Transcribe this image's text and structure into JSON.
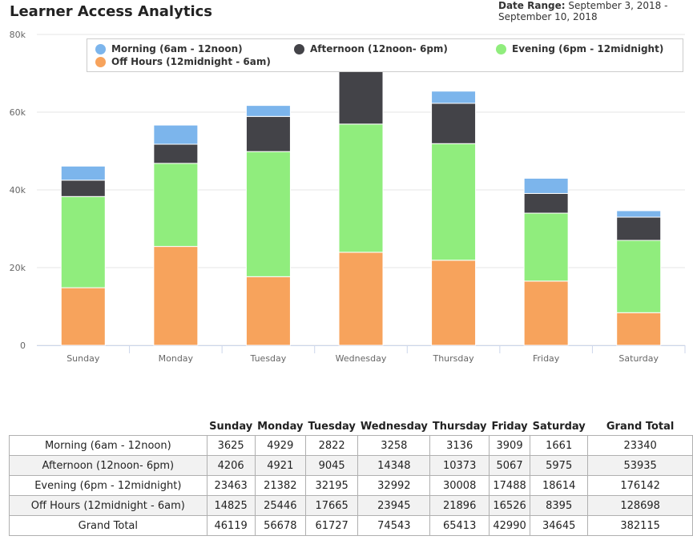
{
  "title": "Learner Access Analytics",
  "date_range": {
    "label": "Date Range:",
    "value": "September 3, 2018 - September 10, 2018"
  },
  "colors": {
    "morning": "#7cb5ec",
    "afternoon": "#434348",
    "evening": "#90ed7d",
    "off_hours": "#f7a35c",
    "grid": "#e6e6e6",
    "axis_text": "#666666"
  },
  "chart_data": {
    "type": "bar",
    "stacked": true,
    "title": "Learner Access Analytics",
    "categories": [
      "Sunday",
      "Monday",
      "Tuesday",
      "Wednesday",
      "Thursday",
      "Friday",
      "Saturday"
    ],
    "series": [
      {
        "name": "Morning (6am - 12noon)",
        "key": "morning",
        "values": [
          3625,
          4929,
          2822,
          3258,
          3136,
          3909,
          1661
        ]
      },
      {
        "name": "Afternoon (12noon- 6pm)",
        "key": "afternoon",
        "values": [
          4206,
          4921,
          9045,
          14348,
          10373,
          5067,
          5975
        ]
      },
      {
        "name": "Evening (6pm - 12midnight)",
        "key": "evening",
        "values": [
          23463,
          21382,
          32195,
          32992,
          30008,
          17488,
          18614
        ]
      },
      {
        "name": "Off Hours (12midnight - 6am)",
        "key": "off_hours",
        "values": [
          14825,
          25446,
          17665,
          23945,
          21896,
          16526,
          8395
        ]
      }
    ],
    "stack_order_bottom_to_top": [
      "off_hours",
      "evening",
      "afternoon",
      "morning"
    ],
    "y_ticks": [
      "0",
      "20k",
      "40k",
      "60k",
      "80k"
    ],
    "ylim": [
      0,
      80000
    ],
    "grid": true,
    "legend_position": "top"
  },
  "table": {
    "headers": [
      "Sunday",
      "Monday",
      "Tuesday",
      "Wednesday",
      "Thursday",
      "Friday",
      "Saturday",
      "Grand Total"
    ],
    "rows": [
      {
        "label": "Morning (6am - 12noon)",
        "cells": [
          "3625",
          "4929",
          "2822",
          "3258",
          "3136",
          "3909",
          "1661",
          "23340"
        ]
      },
      {
        "label": "Afternoon (12noon- 6pm)",
        "cells": [
          "4206",
          "4921",
          "9045",
          "14348",
          "10373",
          "5067",
          "5975",
          "53935"
        ]
      },
      {
        "label": "Evening (6pm - 12midnight)",
        "cells": [
          "23463",
          "21382",
          "32195",
          "32992",
          "30008",
          "17488",
          "18614",
          "176142"
        ]
      },
      {
        "label": "Off Hours (12midnight - 6am)",
        "cells": [
          "14825",
          "25446",
          "17665",
          "23945",
          "21896",
          "16526",
          "8395",
          "128698"
        ]
      },
      {
        "label": "Grand Total",
        "cells": [
          "46119",
          "56678",
          "61727",
          "74543",
          "65413",
          "42990",
          "34645",
          "382115"
        ]
      }
    ]
  }
}
